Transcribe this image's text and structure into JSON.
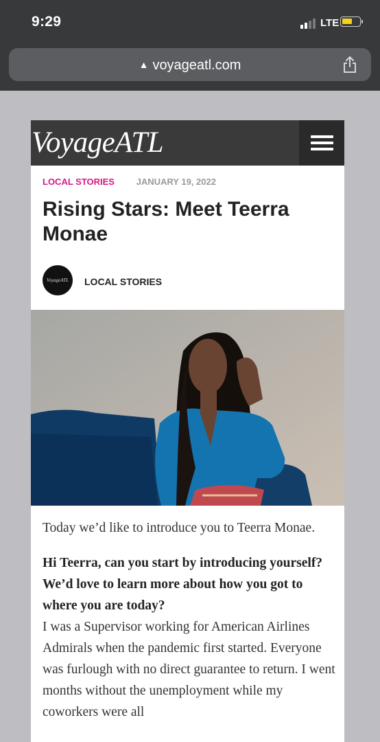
{
  "status_bar": {
    "time": "9:29",
    "network": "LTE"
  },
  "browser": {
    "url": "voyageatl.com"
  },
  "site": {
    "logo": "VoyageATL"
  },
  "article": {
    "category": "LOCAL STORIES",
    "date": "JANUARY 19, 2022",
    "title": "Rising Stars: Meet Teerra Monae",
    "author": {
      "avatar_text": "VoyageATL",
      "name": "LOCAL STORIES"
    },
    "intro": "Today we’d like to introduce you to Teerra Monae.",
    "question": "Hi Teerra, can you start by introducing yourself? We’d love to learn more about how you got to where you are today?",
    "answer": "I was a Supervisor working for American Airlines Admirals when the pandemic first started. Everyone was furlough with no direct guarantee to return. I went months without the unemployment while my coworkers were all"
  },
  "colors": {
    "accent": "#d21a82",
    "header_bg": "#3a3a3a",
    "chrome_bg": "#38393b"
  }
}
